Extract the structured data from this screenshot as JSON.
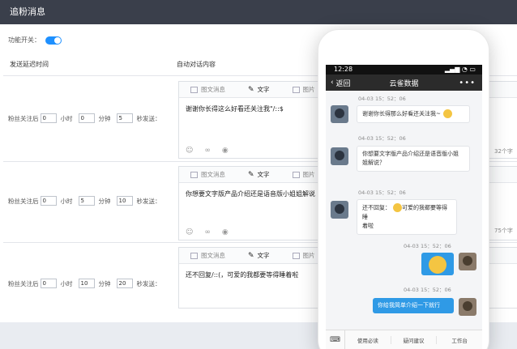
{
  "header": {
    "title": "追粉消息"
  },
  "settings": {
    "toggle_label": "功能开关：",
    "toggle_on": true
  },
  "columns": {
    "delay": "发送延迟时间",
    "content": "自动对话内容"
  },
  "form": {
    "prefix": "粉丝关注后",
    "hour": "小时",
    "minute": "分钟",
    "suffix": "秒发送："
  },
  "tabs": {
    "news": "图文消息",
    "text": "文字",
    "image": "图片"
  },
  "icons": {
    "tab_news": "news-icon",
    "tab_text": "pen-icon",
    "tab_image": "image-icon",
    "tool1": "emoji-icon",
    "tool2": "link-icon",
    "tool3": "eye-icon"
  },
  "rows": [
    {
      "day": "0",
      "hour": "0",
      "minute": "5",
      "text": "谢谢你长得这么好看还关注我\"/::$",
      "count": "32个字"
    },
    {
      "day": "0",
      "hour": "5",
      "minute": "10",
      "text": "你想要文字版产品介绍还是语音版小姐姐解说",
      "count": "75个字"
    },
    {
      "day": "0",
      "hour": "10",
      "minute": "20",
      "text": "还不回复/::(，可爱的我都要等得睡着啦",
      "count": ""
    }
  ],
  "phone": {
    "clock": "12:28",
    "back": "返回",
    "title": "云雀数据",
    "more": "•••",
    "messages": [
      {
        "time": "04-03 15：52：06",
        "text": "谢谢你长得那么好看还关注我~"
      },
      {
        "time": "04-03 15：52：06",
        "line1": "你想要文字版产品介绍还是语音版小姐",
        "line2": "姐解说？"
      },
      {
        "time": "04-03 15：52：06",
        "line1": "还不回复：",
        "line2": "可爱的我都要等得睡",
        "line3": "着啦"
      },
      {
        "time": "04-03 15：52：06"
      },
      {
        "time": "04-03 15：52：06",
        "text": "你给我简单介绍一下就行"
      }
    ],
    "menu": [
      "使用必读",
      "疑问建议",
      "工作台"
    ],
    "colors": {
      "bubble_out": "#2f9ae6",
      "toggle": "#1e90ff",
      "titlebar": "#3a3f4b"
    }
  }
}
